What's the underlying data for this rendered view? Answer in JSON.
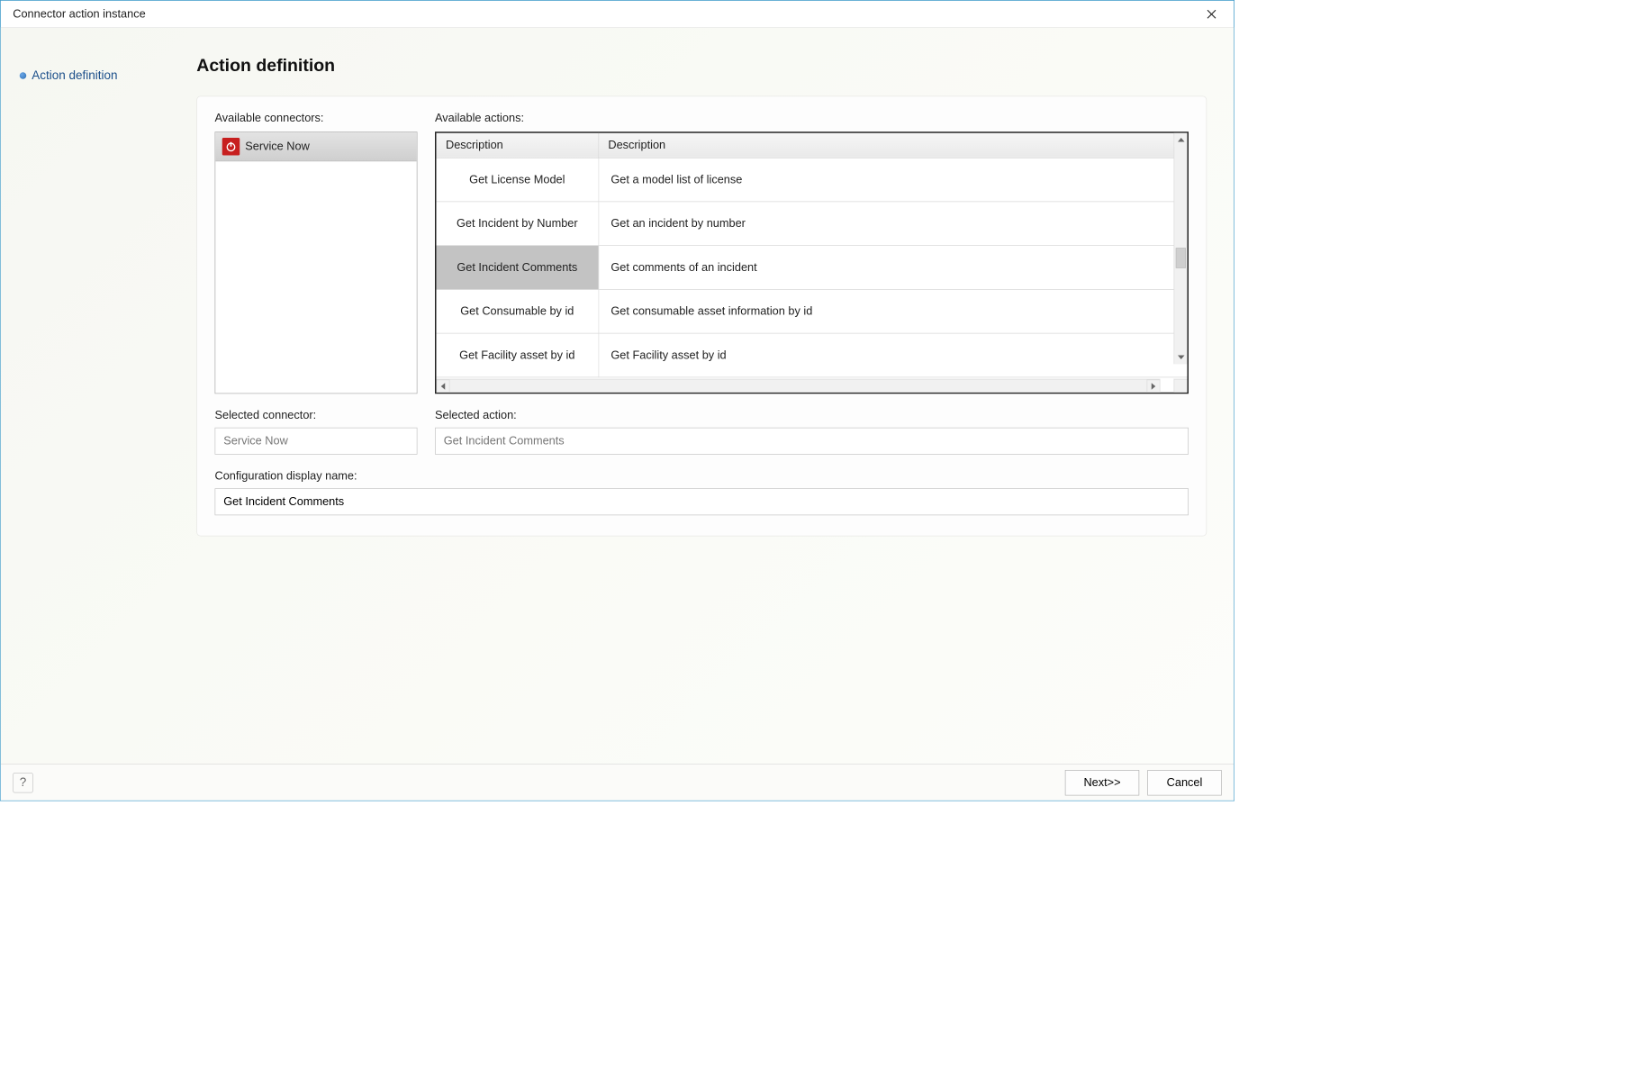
{
  "window": {
    "title": "Connector action instance"
  },
  "nav": {
    "items": [
      "Action definition"
    ]
  },
  "page": {
    "title": "Action definition"
  },
  "connectors": {
    "label": "Available connectors:",
    "items": [
      {
        "name": "Service Now"
      }
    ],
    "selected_label": "Selected connector:",
    "selected_value": "Service Now"
  },
  "actions": {
    "label": "Available actions:",
    "columns": [
      "Description",
      "Description"
    ],
    "rows": [
      {
        "name": "Get License Model",
        "desc": "Get a model list of license",
        "selected": false
      },
      {
        "name": "Get Incident by Number",
        "desc": "Get an incident by number",
        "selected": false
      },
      {
        "name": "Get Incident Comments",
        "desc": "Get comments of an incident",
        "selected": true
      },
      {
        "name": "Get Consumable by id",
        "desc": "Get consumable asset information by id",
        "selected": false
      },
      {
        "name": "Get Facility asset by id",
        "desc": "Get Facility asset by id",
        "selected": false
      }
    ],
    "selected_label": "Selected action:",
    "selected_value": "Get Incident Comments"
  },
  "config_name": {
    "label": "Configuration display name:",
    "value": "Get Incident Comments"
  },
  "footer": {
    "next": "Next>>",
    "cancel": "Cancel",
    "help_tooltip": "Help"
  }
}
